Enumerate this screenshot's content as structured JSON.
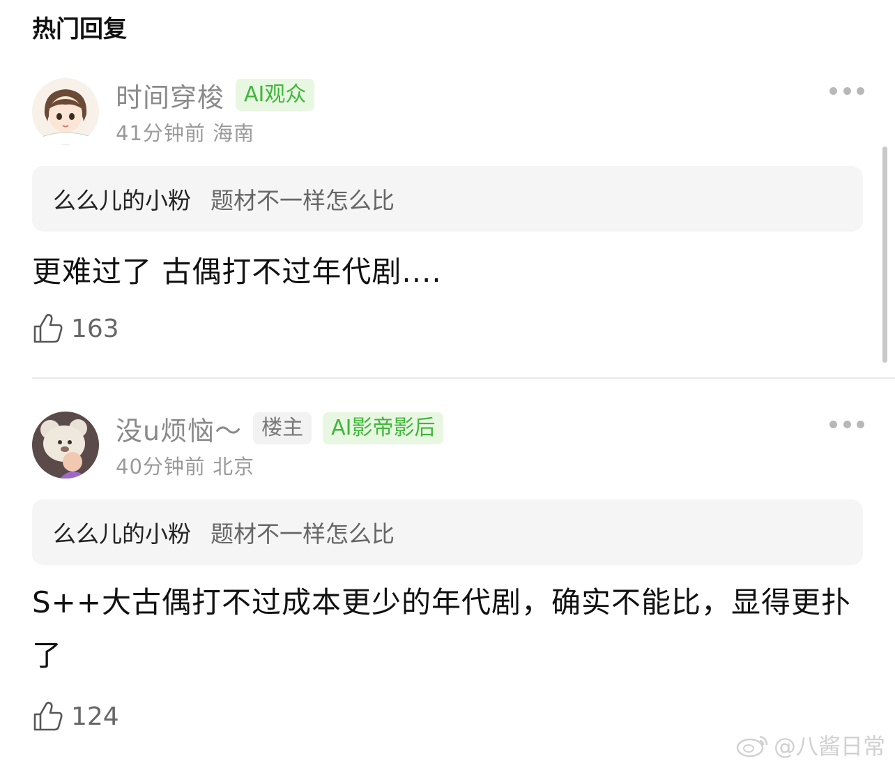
{
  "section_title": "热门回复",
  "comments": [
    {
      "username": "时间穿梭",
      "badges": [
        "AI观众"
      ],
      "time": "41分钟前",
      "location": "海南",
      "quote_user": "么么儿的小粉",
      "quote_text": "题材不一样怎么比",
      "content": "更难过了 古偶打不过年代剧....",
      "likes": "163"
    },
    {
      "username": "没u烦恼～",
      "owner_badge": "楼主",
      "badges": [
        "AI影帝影后"
      ],
      "time": "40分钟前",
      "location": "北京",
      "quote_user": "么么儿的小粉",
      "quote_text": "题材不一样怎么比",
      "content": "S++大古偶打不过成本更少的年代剧，确实不能比，显得更扑了",
      "likes": "124"
    }
  ],
  "watermark": "@八酱日常",
  "icons": {
    "more": "more-icon",
    "like": "thumbs-up-icon",
    "weibo": "weibo-logo-icon"
  },
  "colors": {
    "ai_badge_bg": "#e8f7e1",
    "ai_badge_text": "#3fb63a"
  }
}
